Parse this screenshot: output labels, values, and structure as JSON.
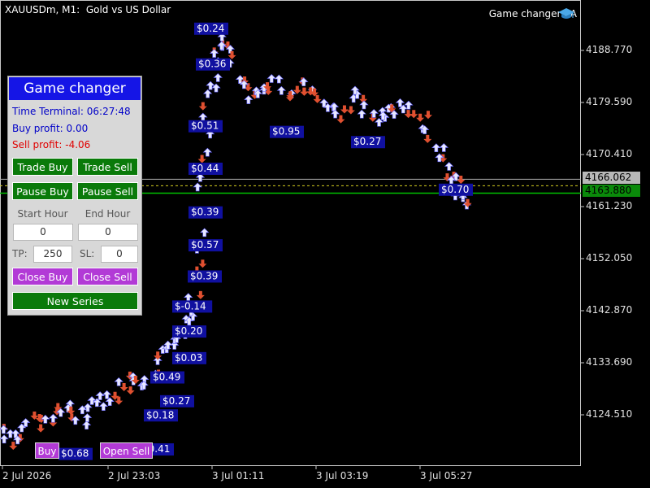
{
  "chart": {
    "title": "XAUUSDm, M1:  Gold vs US Dollar",
    "ea_name": "Game changer EA",
    "price_axis": [
      "4188.770",
      "4179.590",
      "4170.410",
      "4161.230",
      "4152.050",
      "4142.870",
      "4133.690",
      "4124.510"
    ],
    "bid_price": "4166.062",
    "ask_price": "4163.880",
    "time_axis": [
      "2 Jul 2026",
      "2 Jul 23:03",
      "3 Jul 01:11",
      "3 Jul 03:19",
      "3 Jul 05:27"
    ],
    "colors": {
      "background": "#000000",
      "buy_arrow": "#e8e8ff",
      "sell_arrow": "#e05030",
      "label_bg": "#1010a0",
      "ask_line": "#00c000",
      "bid_line": "#b0b0b0"
    }
  },
  "chart_data": {
    "type": "scatter",
    "profit_labels": [
      {
        "x": "3 Jul 00:52",
        "y": 4192.1,
        "text": "$0.24"
      },
      {
        "x": "3 Jul 00:54",
        "y": 4185.8,
        "text": "$0.36"
      },
      {
        "x": "3 Jul 00:45",
        "y": 4174.9,
        "text": "$0.51"
      },
      {
        "x": "3 Jul 00:45",
        "y": 4167.4,
        "text": "$0.44"
      },
      {
        "x": "3 Jul 00:45",
        "y": 4159.7,
        "text": "$0.39"
      },
      {
        "x": "3 Jul 00:45",
        "y": 4153.9,
        "text": "$0.57"
      },
      {
        "x": "3 Jul 00:44",
        "y": 4148.4,
        "text": "$0.39"
      },
      {
        "x": "3 Jul 00:25",
        "y": 4143.1,
        "text": "$-0.14"
      },
      {
        "x": "3 Jul 00:25",
        "y": 4138.7,
        "text": "$0.20"
      },
      {
        "x": "3 Jul 00:25",
        "y": 4134.0,
        "text": "$0.03"
      },
      {
        "x": "2 Jul 23:58",
        "y": 4130.6,
        "text": "$0.49"
      },
      {
        "x": "3 Jul 00:10",
        "y": 4126.4,
        "text": "$0.27"
      },
      {
        "x": "2 Jul 23:50",
        "y": 4123.9,
        "text": "$0.18"
      },
      {
        "x": "2 Jul 23:45",
        "y": 4117.9,
        "text": "$0.41"
      },
      {
        "x": "2 Jul 22:05",
        "y": 4117.1,
        "text": "$0.68"
      },
      {
        "x": "3 Jul 02:25",
        "y": 4173.9,
        "text": "$0.95"
      },
      {
        "x": "3 Jul 04:05",
        "y": 4172.1,
        "text": "$0.27"
      },
      {
        "x": "3 Jul 05:53",
        "y": 4163.7,
        "text": "$0.70"
      }
    ]
  },
  "panel": {
    "title": "Game changer",
    "time_terminal": "Time Terminal: 06:27:48",
    "buy_profit": "Buy profit: 0.00",
    "sell_profit": "Sell profit: -4.06",
    "trade_buy": "Trade Buy",
    "trade_sell": "Trade Sell",
    "pause_buy": "Pause Buy",
    "pause_sell": "Pause Sell",
    "start_hour_label": "Start Hour",
    "end_hour_label": "End Hour",
    "start_hour_value": "0",
    "end_hour_value": "0",
    "tp_label": "TP:",
    "tp_value": "250",
    "sl_label": "SL:",
    "sl_value": "0",
    "close_buy": "Close Buy",
    "close_sell": "Close Sell",
    "new_series": "New Series"
  },
  "bottom_buttons": {
    "buy": "Buy",
    "open_sell": "Open Sell"
  }
}
